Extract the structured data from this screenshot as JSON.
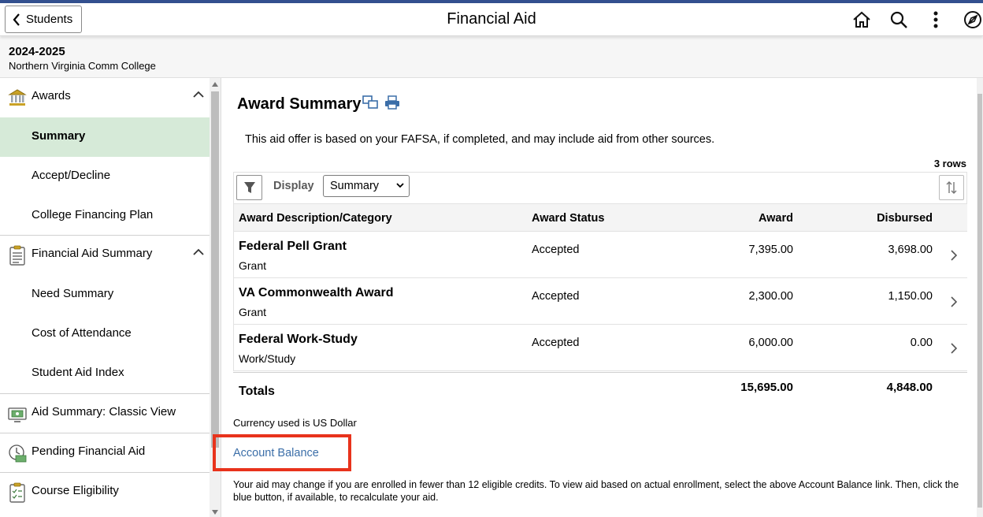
{
  "header": {
    "back_label": "Students",
    "title": "Financial Aid",
    "icons": [
      "home-icon",
      "search-icon",
      "more-vertical-icon",
      "compass-icon"
    ]
  },
  "context": {
    "year": "2024-2025",
    "college": "Northern Virginia Comm College"
  },
  "sidebar": {
    "groups": [
      {
        "label": "Awards",
        "icon": "bank-icon",
        "expanded": true,
        "items": [
          {
            "label": "Summary",
            "active": true
          },
          {
            "label": "Accept/Decline"
          },
          {
            "label": "College Financing Plan"
          }
        ]
      },
      {
        "label": "Financial Aid Summary",
        "icon": "clipboard-icon",
        "expanded": true,
        "items": [
          {
            "label": "Need Summary"
          },
          {
            "label": "Cost of Attendance"
          },
          {
            "label": "Student Aid Index"
          }
        ]
      },
      {
        "label": "Aid Summary: Classic View",
        "icon": "monitor-money-icon"
      },
      {
        "label": "Pending Financial Aid",
        "icon": "money-clock-icon"
      },
      {
        "label": "Course Eligibility",
        "icon": "checklist-icon"
      }
    ]
  },
  "main": {
    "title": "Award Summary",
    "title_icons": [
      "new-window-icon",
      "print-icon"
    ],
    "intro": "This aid offer is based on your FAFSA, if completed, and may include aid from other sources.",
    "row_count": "3 rows",
    "display_label": "Display",
    "display_value": "Summary",
    "columns": [
      "Award Description/Category",
      "Award Status",
      "Award",
      "Disbursed"
    ],
    "rows": [
      {
        "description": "Federal Pell Grant",
        "category": "Grant",
        "status": "Accepted",
        "award": "7,395.00",
        "disbursed": "3,698.00"
      },
      {
        "description": "VA Commonwealth Award",
        "category": "Grant",
        "status": "Accepted",
        "award": "2,300.00",
        "disbursed": "1,150.00"
      },
      {
        "description": "Federal Work-Study",
        "category": "Work/Study",
        "status": "Accepted",
        "award": "6,000.00",
        "disbursed": "0.00"
      }
    ],
    "totals": {
      "label": "Totals",
      "award": "15,695.00",
      "disbursed": "4,848.00"
    },
    "currency": "Currency used is US Dollar",
    "account_link": "Account Balance",
    "note": "Your aid may change if you are enrolled in fewer than 12 eligible credits. To view aid based on actual enrollment, select the above Account Balance link. Then, click the blue button, if available, to recalculate your aid."
  },
  "colors": {
    "top_stripe": "#33508f",
    "active_nav": "#d6ead8",
    "link": "#3b6ea8",
    "highlight": "#e8331c"
  }
}
